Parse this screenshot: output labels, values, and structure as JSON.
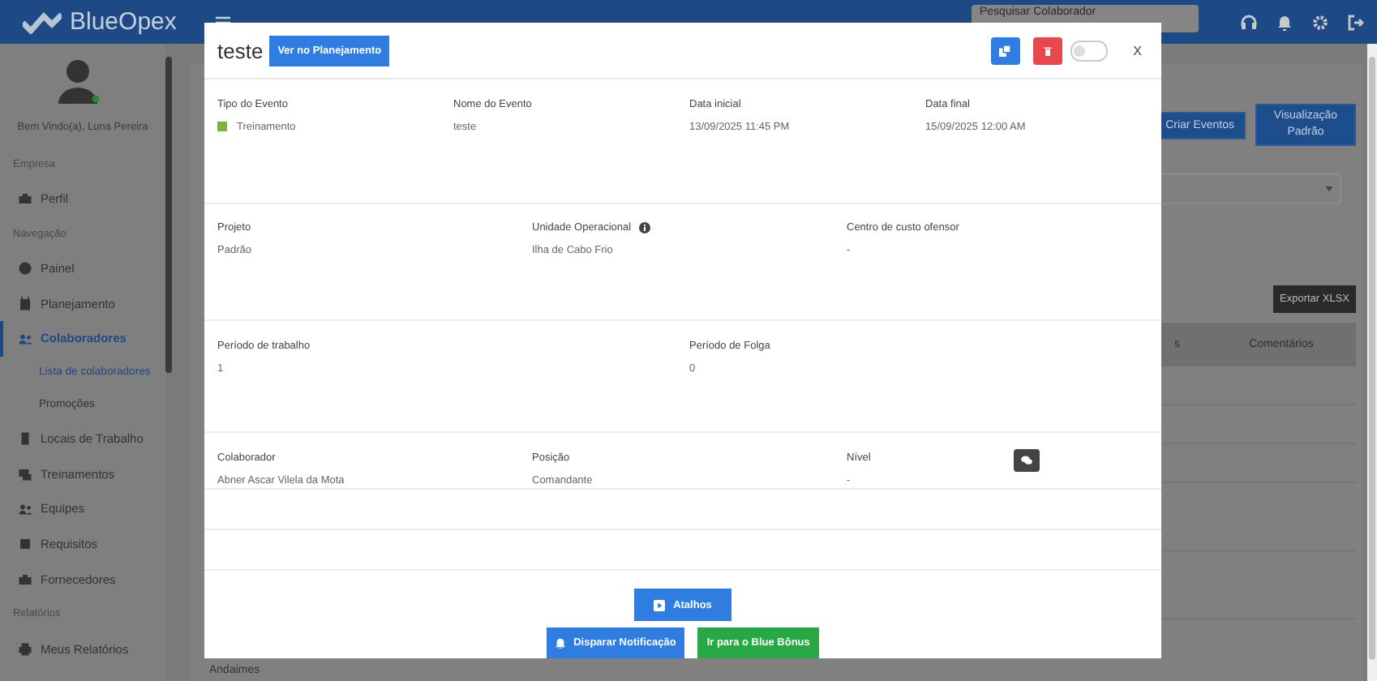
{
  "header": {
    "brand": "BlueOpex",
    "search": {
      "placeholder": "Pesquisar Colaborador"
    }
  },
  "sidebar": {
    "user": "Bem Vindo(a), Luna Pereira",
    "online": true,
    "sections": [
      {
        "title": "Empresa",
        "items": [
          {
            "label": "Perfil",
            "kind": "briefcase",
            "selected": false
          }
        ]
      },
      {
        "title": "Navegação",
        "items": [
          {
            "label": "Painel",
            "kind": "gauge",
            "selected": false
          },
          {
            "label": "Planejamento",
            "kind": "calendar",
            "selected": false
          },
          {
            "label": "Colaboradores",
            "kind": "users",
            "selected": true,
            "children": [
              {
                "label": "Lista de colaboradores",
                "selected": true
              },
              {
                "label": "Promoções",
                "selected": false
              }
            ]
          },
          {
            "label": "Locais de Trabalho",
            "kind": "building",
            "selected": false
          },
          {
            "label": "Treinamentos",
            "kind": "laptop",
            "selected": false
          },
          {
            "label": "Equipes",
            "kind": "users",
            "selected": false
          },
          {
            "label": "Requisitos",
            "kind": "check",
            "selected": false
          },
          {
            "label": "Fornecedores",
            "kind": "briefcase",
            "selected": false
          }
        ]
      },
      {
        "title": "Relatórios",
        "items": [
          {
            "label": "Meus Relatórios",
            "kind": "printer",
            "selected": false
          }
        ]
      }
    ]
  },
  "page": {
    "buttons": [
      "Criar Eventos",
      "Visualização Padrão"
    ],
    "export_button": "Exportar XLSX",
    "table": {
      "columns": [
        "s",
        "Comentários"
      ],
      "rows": [
        {
          "column_1": "Andaimes"
        }
      ]
    }
  },
  "modal": {
    "title": "teste",
    "plan_button": "Ver no Planejamento",
    "toggle_on": false,
    "close": "X",
    "sections": [
      {
        "kind": "fields",
        "fields": [
          {
            "label": "Tipo do Evento",
            "value": "Treinamento",
            "color": "#7cb342"
          },
          {
            "label": "Nome do Evento",
            "value": "teste"
          },
          {
            "label": "Data inicial",
            "value": "13/09/2025 11:45 PM"
          },
          {
            "label": "Data final",
            "value": "15/09/2025 12:00 AM"
          }
        ]
      },
      {
        "kind": "fields",
        "fields": [
          {
            "label": "Projeto",
            "value": "Padrão"
          },
          {
            "label": "Unidade Operacional",
            "value": "Ilha de Cabo Frio",
            "info": true
          },
          {
            "label": "Centro de custo ofensor",
            "value": "-"
          }
        ]
      },
      {
        "kind": "fields",
        "fields": [
          {
            "label": "Período de trabalho",
            "value": "1"
          },
          {
            "label": "Período de Folga",
            "value": "0"
          }
        ]
      },
      {
        "kind": "fields",
        "fields": [
          {
            "label": "Colaborador",
            "value": "Abner Ascar Vilela da Mota"
          },
          {
            "label": "Posição",
            "value": "Comandante"
          },
          {
            "label": "Nível",
            "value": "-",
            "chat": true
          }
        ]
      },
      {
        "kind": "blank"
      },
      {
        "kind": "blank"
      }
    ],
    "footer": {
      "shortcut_button": "Atalhos",
      "buttons": [
        {
          "label": "Disparar Notificação",
          "kind": "notify"
        },
        {
          "label": "Ir para o Blue Bônus",
          "kind": "bonus"
        }
      ]
    }
  }
}
